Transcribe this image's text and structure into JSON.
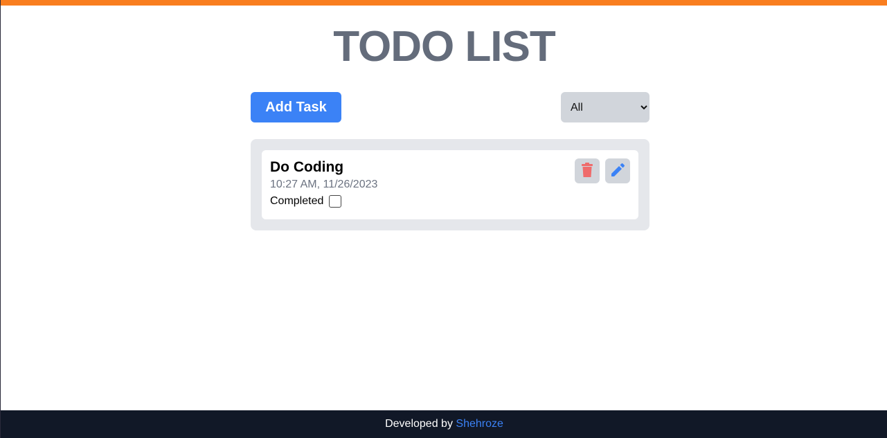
{
  "header": {
    "title": "TODO LIST"
  },
  "toolbar": {
    "add_label": "Add Task",
    "filter": {
      "selected": "All",
      "options": [
        "All"
      ]
    }
  },
  "tasks": [
    {
      "title": "Do Coding",
      "time": "10:27 AM, 11/26/2023",
      "status_label": "Completed",
      "completed": false,
      "delete_icon": "trash-icon",
      "edit_icon": "pencil-icon"
    }
  ],
  "footer": {
    "prefix": "Developed by",
    "author": "Shehroze"
  },
  "colors": {
    "accent_orange": "#f97e1f",
    "primary_blue": "#3b82f6",
    "delete_red": "#ef6b6b",
    "footer_bg": "#111827"
  }
}
